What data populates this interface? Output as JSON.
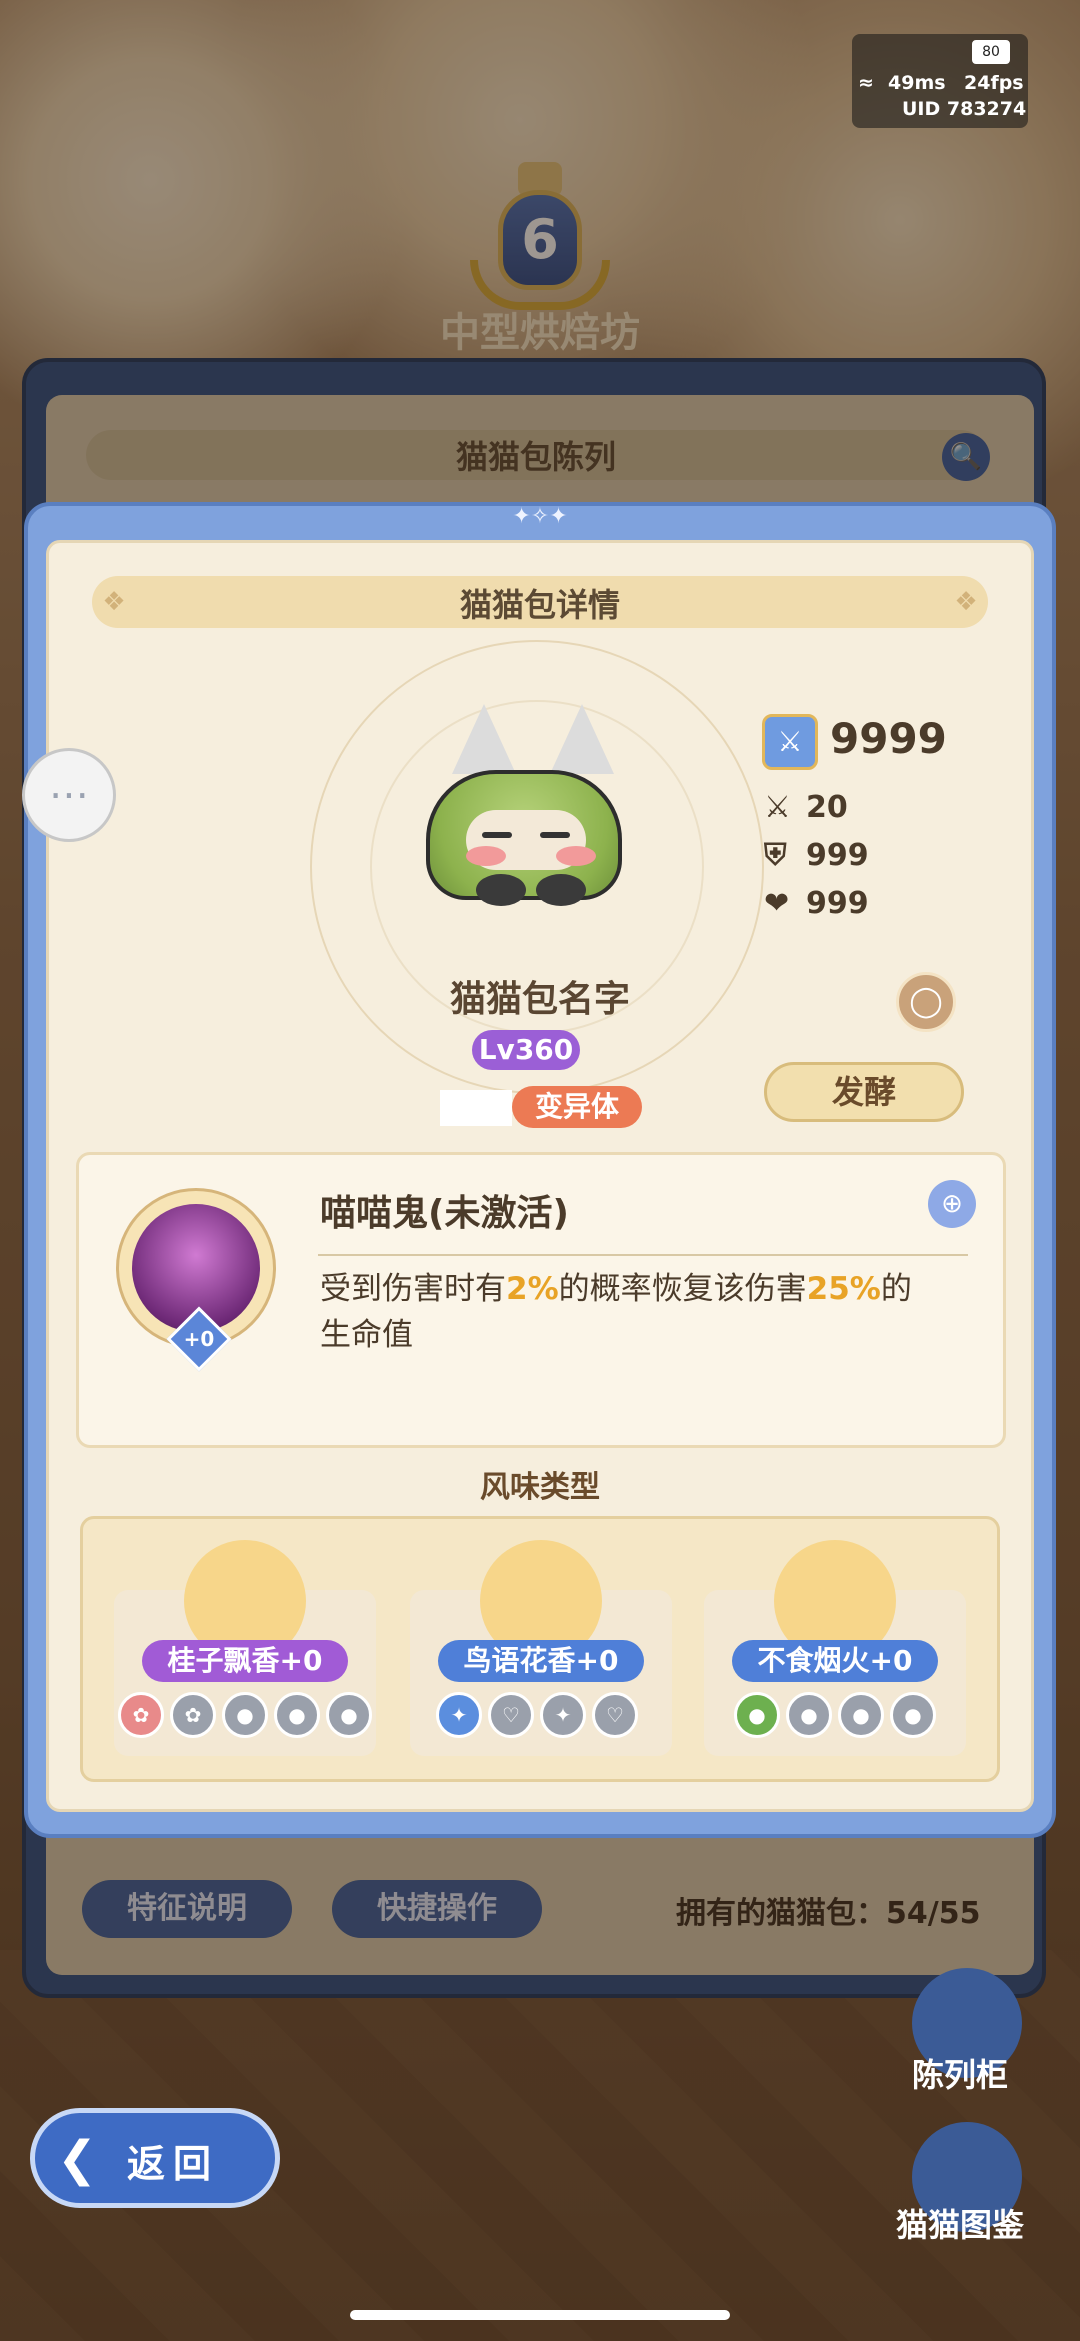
{
  "status": {
    "battery": "80",
    "ping": "49ms",
    "fps": "24fps",
    "uid": "UID 783274"
  },
  "room": {
    "level": "6",
    "title": "中型烘焙坊"
  },
  "back_panel": {
    "title": "猫猫包陈列",
    "feature_btn": "特征说明",
    "quick_btn": "快捷操作",
    "owned": "拥有的猫猫包：54/55"
  },
  "dialog": {
    "title": "猫猫包详情",
    "bun_name": "猫猫包名字",
    "level": "Lv360",
    "mutant": "变异体",
    "power": "9999",
    "attack": "20",
    "defense": "999",
    "health": "999",
    "ferment_btn": "发酵"
  },
  "skill": {
    "name": "喵喵鬼(未激活)",
    "plus": "+0",
    "desc_a": "受到伤害时有",
    "pct1": "2%",
    "desc_b": "的概率恢复该伤害",
    "pct2": "25%",
    "desc_c": "的",
    "desc_d": "生命值"
  },
  "flavor": {
    "title": "风味类型",
    "items": [
      {
        "label": "桂子飘香+0",
        "color": "#a15bd6"
      },
      {
        "label": "鸟语花香+0",
        "color": "#4f7fd8"
      },
      {
        "label": "不食烟火+0",
        "color": "#4f7fd8"
      }
    ]
  },
  "side": {
    "cabinet": "陈列柜",
    "codex": "猫猫图鉴",
    "back": "返回"
  }
}
